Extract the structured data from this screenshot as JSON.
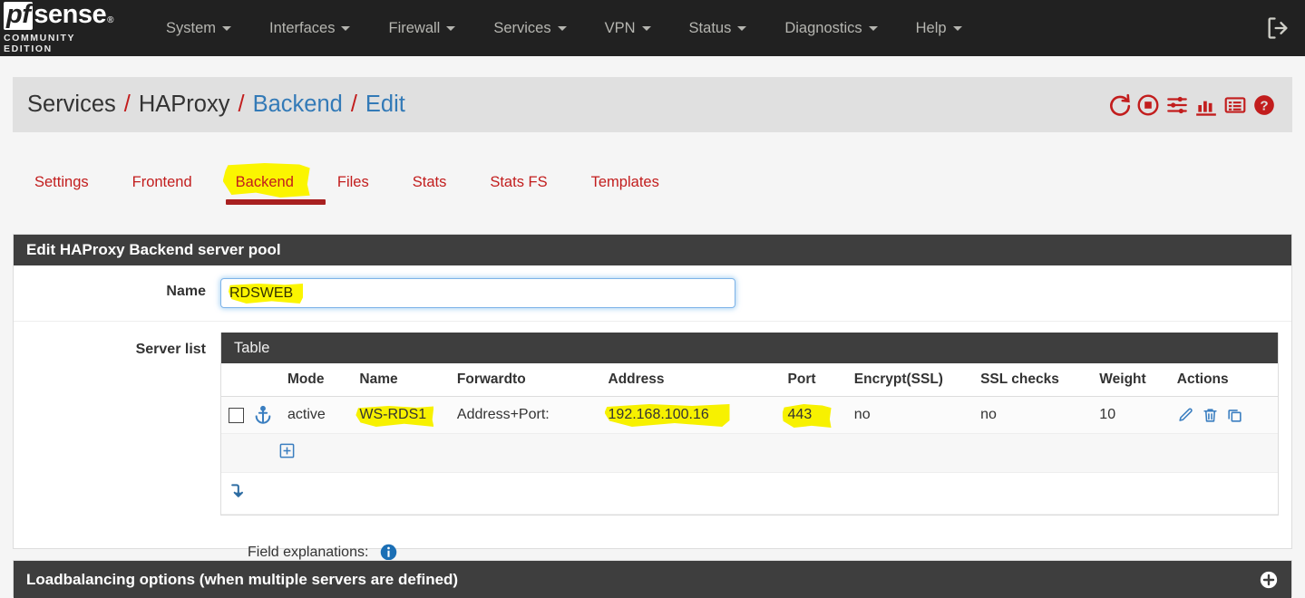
{
  "navbar": {
    "brand": {
      "pf": "pf",
      "sense": "sense",
      "reg": "®",
      "subtitle": "COMMUNITY EDITION"
    },
    "items": [
      {
        "label": "System"
      },
      {
        "label": "Interfaces"
      },
      {
        "label": "Firewall"
      },
      {
        "label": "Services"
      },
      {
        "label": "VPN"
      },
      {
        "label": "Status"
      },
      {
        "label": "Diagnostics"
      },
      {
        "label": "Help"
      }
    ],
    "logout_icon": "logout-icon"
  },
  "header": {
    "crumb1": "Services",
    "crumb2": "HAProxy",
    "crumb3": "Backend",
    "crumb4": "Edit",
    "separator": "/",
    "icons": [
      {
        "name": "refresh-icon"
      },
      {
        "name": "stop-icon"
      },
      {
        "name": "sliders-icon"
      },
      {
        "name": "bar-chart-icon"
      },
      {
        "name": "log-list-icon"
      },
      {
        "name": "help-circle-icon"
      }
    ],
    "accent_color": "#c21d1d",
    "link_color": "#337ab7"
  },
  "tabs": [
    {
      "label": "Settings",
      "active": false
    },
    {
      "label": "Frontend",
      "active": false
    },
    {
      "label": "Backend",
      "active": true
    },
    {
      "label": "Files",
      "active": false
    },
    {
      "label": "Stats",
      "active": false
    },
    {
      "label": "Stats FS",
      "active": false
    },
    {
      "label": "Templates",
      "active": false
    }
  ],
  "main_panel": {
    "title": "Edit HAProxy Backend server pool",
    "name_field": {
      "label": "Name",
      "value": "RDSWEB",
      "placeholder": ""
    },
    "server_list": {
      "label": "Server list",
      "table_title": "Table",
      "columns": [
        "",
        "Mode",
        "Name",
        "Forwardto",
        "Address",
        "Port",
        "Encrypt(SSL)",
        "SSL checks",
        "Weight",
        "Actions"
      ],
      "rows": [
        {
          "checkbox_checked": false,
          "anchor_icon": "anchor-icon",
          "mode": "active",
          "name": "WS-RDS1",
          "forwardto": "Address+Port:",
          "address": "192.168.100.16",
          "port": "443",
          "encrypt_ssl": "no",
          "ssl_checks": "no",
          "weight": "10",
          "actions": [
            "edit-pencil-icon",
            "delete-trash-icon",
            "duplicate-copy-icon"
          ]
        }
      ],
      "add_row_icon": "add-plus-square-icon",
      "move_down_icon": "move-down-arrow-icon"
    },
    "field_explanations": {
      "label": "Field explanations:",
      "icon": "info-circle-icon"
    }
  },
  "bottom_panel": {
    "title": "Loadbalancing options (when multiple servers are defined)",
    "expand_icon": "expand-plus-circle-icon"
  },
  "highlight_color": "#fbf500"
}
